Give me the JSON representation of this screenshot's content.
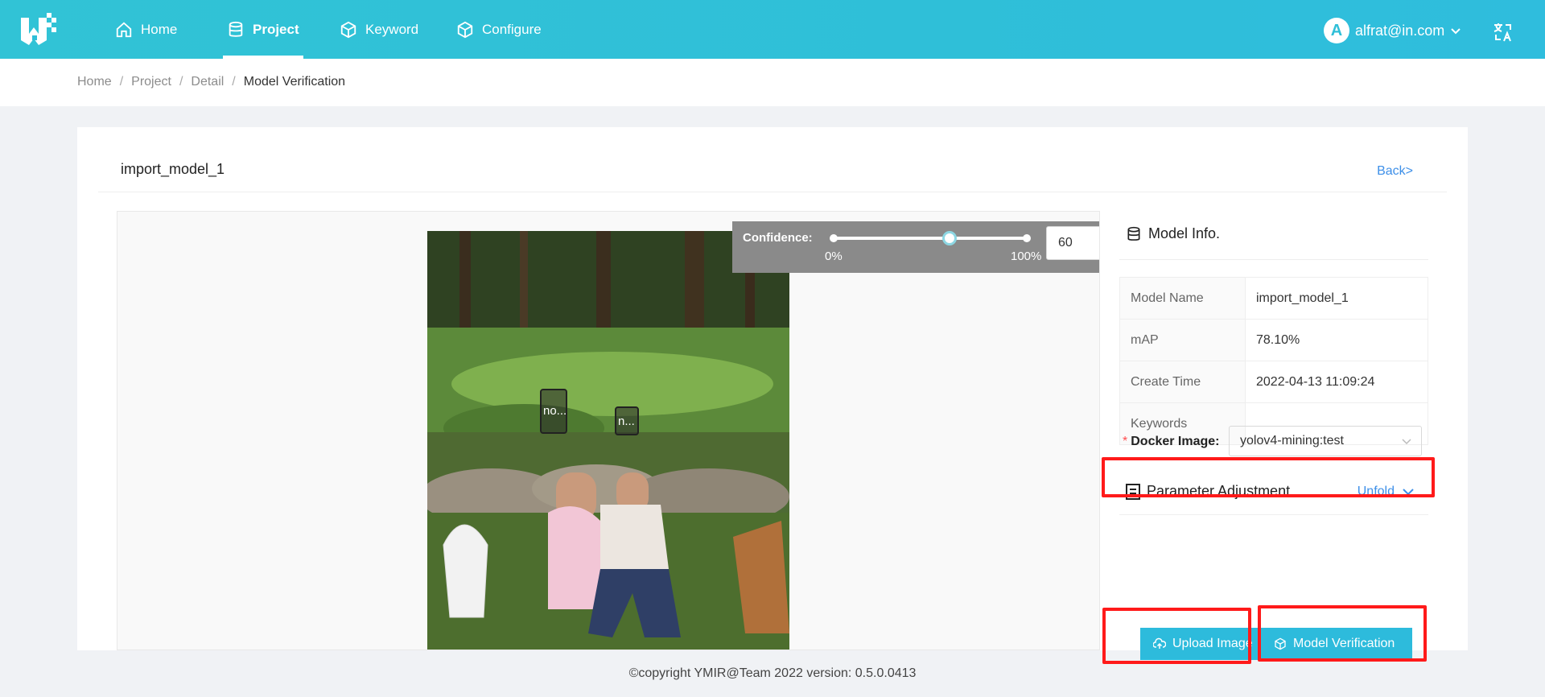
{
  "nav": {
    "home": "Home",
    "project": "Project",
    "keyword": "Keyword",
    "configure": "Configure"
  },
  "user": {
    "initial": "A",
    "email": "alfrat@in.com"
  },
  "breadcrumb": {
    "items": [
      "Home",
      "Project",
      "Detail"
    ],
    "current": "Model Verification",
    "separator": "/"
  },
  "card": {
    "title": "import_model_1",
    "back": "Back>"
  },
  "confidence": {
    "label": "Confidence:",
    "min_label": "0%",
    "max_label": "100%",
    "value": "60",
    "value_fraction": 0.6
  },
  "detections": [
    {
      "label": "no..."
    },
    {
      "label": "n..."
    }
  ],
  "model_info": {
    "title": "Model Info.",
    "rows": [
      {
        "key": "Model Name",
        "value": "import_model_1"
      },
      {
        "key": "mAP",
        "value": "78.10%"
      },
      {
        "key": "Create Time",
        "value": "2022-04-13 11:09:24"
      },
      {
        "key": "Keywords",
        "value": ""
      }
    ]
  },
  "docker": {
    "label": "Docker Image:",
    "required_mark": "*",
    "selected": "yolov4-mining:test"
  },
  "param": {
    "title": "Parameter Adjustment",
    "toggle": "Unfold"
  },
  "buttons": {
    "upload": "Upload Image",
    "verify": "Model Verification"
  },
  "footer": "©copyright YMIR@Team 2022 version: 0.5.0.0413",
  "colors": {
    "header": "#2fbfd8",
    "primary": "#2dbbdc",
    "link": "#3d8fe8",
    "highlight": "#ff1a1a"
  }
}
